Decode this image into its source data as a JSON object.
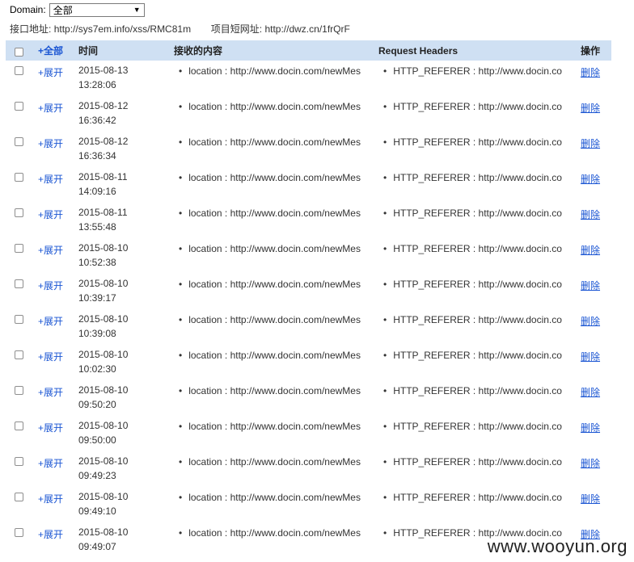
{
  "domain_filter": {
    "label": "Domain:",
    "selected": "全部"
  },
  "address": {
    "api_label": "接口地址:",
    "api_url": "http://sys7em.info/xss/RMC81m",
    "short_label": "项目短网址:",
    "short_url": "http://dwz.cn/1frQrF"
  },
  "table": {
    "headers": {
      "expand_all": "+全部",
      "time": "时间",
      "content": "接收的内容",
      "request_headers": "Request Headers",
      "action": "操作"
    },
    "rows": [
      {
        "expand": "+展开",
        "date": "2015-08-13",
        "time": "13:28:06",
        "content": "location : http://www.docin.com/newMes",
        "header": "HTTP_REFERER : http://www.docin.co",
        "action": "删除"
      },
      {
        "expand": "+展开",
        "date": "2015-08-12",
        "time": "16:36:42",
        "content": "location : http://www.docin.com/newMes",
        "header": "HTTP_REFERER : http://www.docin.co",
        "action": "删除"
      },
      {
        "expand": "+展开",
        "date": "2015-08-12",
        "time": "16:36:34",
        "content": "location : http://www.docin.com/newMes",
        "header": "HTTP_REFERER : http://www.docin.co",
        "action": "删除"
      },
      {
        "expand": "+展开",
        "date": "2015-08-11",
        "time": "14:09:16",
        "content": "location : http://www.docin.com/newMes",
        "header": "HTTP_REFERER : http://www.docin.co",
        "action": "删除"
      },
      {
        "expand": "+展开",
        "date": "2015-08-11",
        "time": "13:55:48",
        "content": "location : http://www.docin.com/newMes",
        "header": "HTTP_REFERER : http://www.docin.co",
        "action": "删除"
      },
      {
        "expand": "+展开",
        "date": "2015-08-10",
        "time": "10:52:38",
        "content": "location : http://www.docin.com/newMes",
        "header": "HTTP_REFERER : http://www.docin.co",
        "action": "删除"
      },
      {
        "expand": "+展开",
        "date": "2015-08-10",
        "time": "10:39:17",
        "content": "location : http://www.docin.com/newMes",
        "header": "HTTP_REFERER : http://www.docin.co",
        "action": "删除"
      },
      {
        "expand": "+展开",
        "date": "2015-08-10",
        "time": "10:39:08",
        "content": "location : http://www.docin.com/newMes",
        "header": "HTTP_REFERER : http://www.docin.co",
        "action": "删除"
      },
      {
        "expand": "+展开",
        "date": "2015-08-10",
        "time": "10:02:30",
        "content": "location : http://www.docin.com/newMes",
        "header": "HTTP_REFERER : http://www.docin.co",
        "action": "删除"
      },
      {
        "expand": "+展开",
        "date": "2015-08-10",
        "time": "09:50:20",
        "content": "location : http://www.docin.com/newMes",
        "header": "HTTP_REFERER : http://www.docin.co",
        "action": "删除"
      },
      {
        "expand": "+展开",
        "date": "2015-08-10",
        "time": "09:50:00",
        "content": "location : http://www.docin.com/newMes",
        "header": "HTTP_REFERER : http://www.docin.co",
        "action": "删除"
      },
      {
        "expand": "+展开",
        "date": "2015-08-10",
        "time": "09:49:23",
        "content": "location : http://www.docin.com/newMes",
        "header": "HTTP_REFERER : http://www.docin.co",
        "action": "删除"
      },
      {
        "expand": "+展开",
        "date": "2015-08-10",
        "time": "09:49:10",
        "content": "location : http://www.docin.com/newMes",
        "header": "HTTP_REFERER : http://www.docin.co",
        "action": "删除"
      },
      {
        "expand": "+展开",
        "date": "2015-08-10",
        "time": "09:49:07",
        "content": "location : http://www.docin.com/newMes",
        "header": "HTTP_REFERER : http://www.docin.co",
        "action": "删除"
      }
    ]
  },
  "watermark": "www.wooyun.org",
  "colors": {
    "header_bg": "#cfe0f3",
    "link": "#1a55d3"
  }
}
